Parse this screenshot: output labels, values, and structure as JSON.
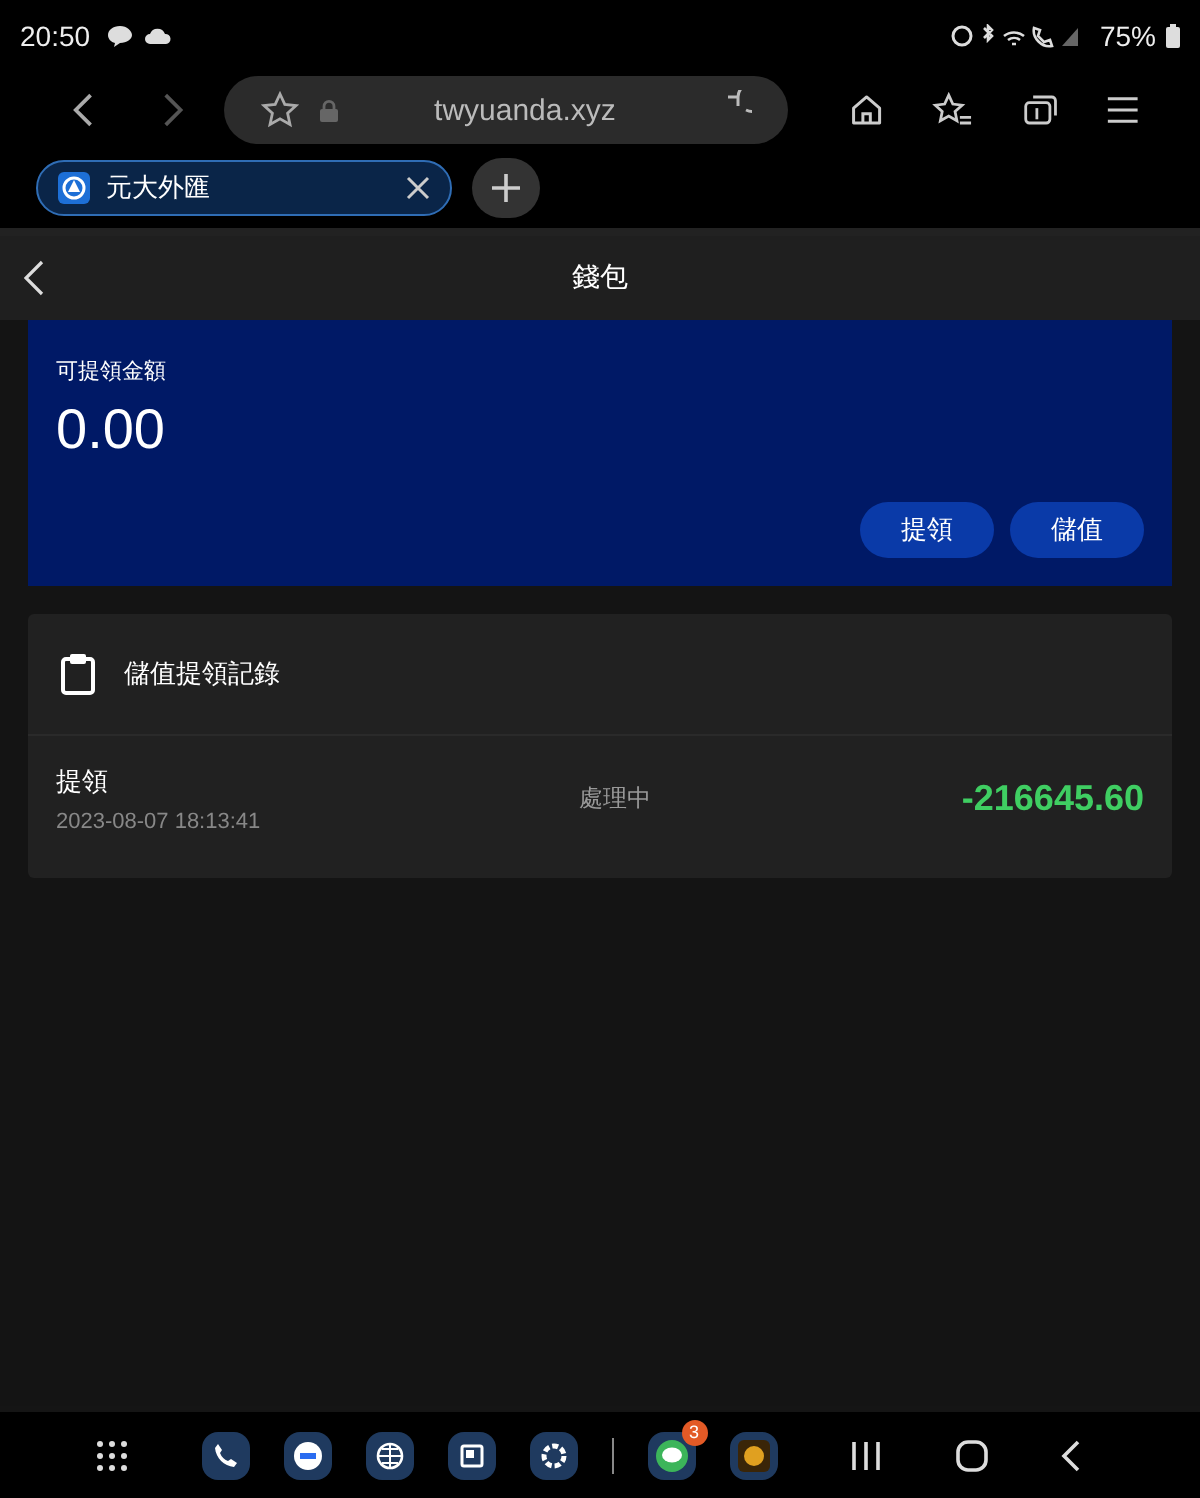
{
  "status_bar": {
    "time": "20:50",
    "battery": "75%"
  },
  "browser": {
    "url": "twyuanda.xyz",
    "tabs": [
      {
        "title": "元大外匯",
        "selected": true
      }
    ]
  },
  "page": {
    "title": "錢包",
    "balance": {
      "label": "可提領金額",
      "amount": "0.00"
    },
    "buttons": [
      "提領",
      "儲值"
    ],
    "records": {
      "title": "儲值提領記錄",
      "items": [
        {
          "type": "提領",
          "time": "2023-08-07 18:13:41",
          "status": "處理中",
          "amount": "-216645.60"
        }
      ]
    }
  },
  "dock": {
    "badge": "3"
  }
}
